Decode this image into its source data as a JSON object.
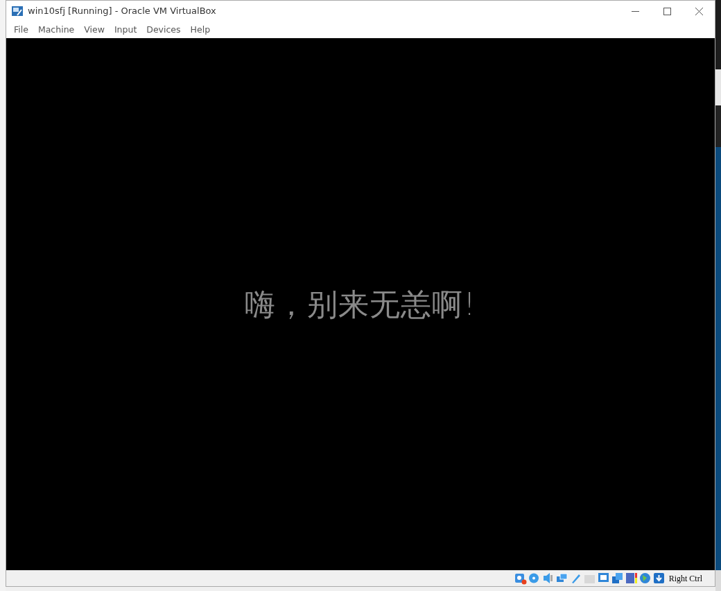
{
  "window": {
    "title": "win10sfj [Running] - Oracle VM VirtualBox"
  },
  "menu": [
    {
      "label": "File"
    },
    {
      "label": "Machine"
    },
    {
      "label": "View"
    },
    {
      "label": "Input"
    },
    {
      "label": "Devices"
    },
    {
      "label": "Help"
    }
  ],
  "screen": {
    "message": "嗨，别来无恙啊!"
  },
  "status_bar": {
    "host_key": "Right Ctrl"
  }
}
